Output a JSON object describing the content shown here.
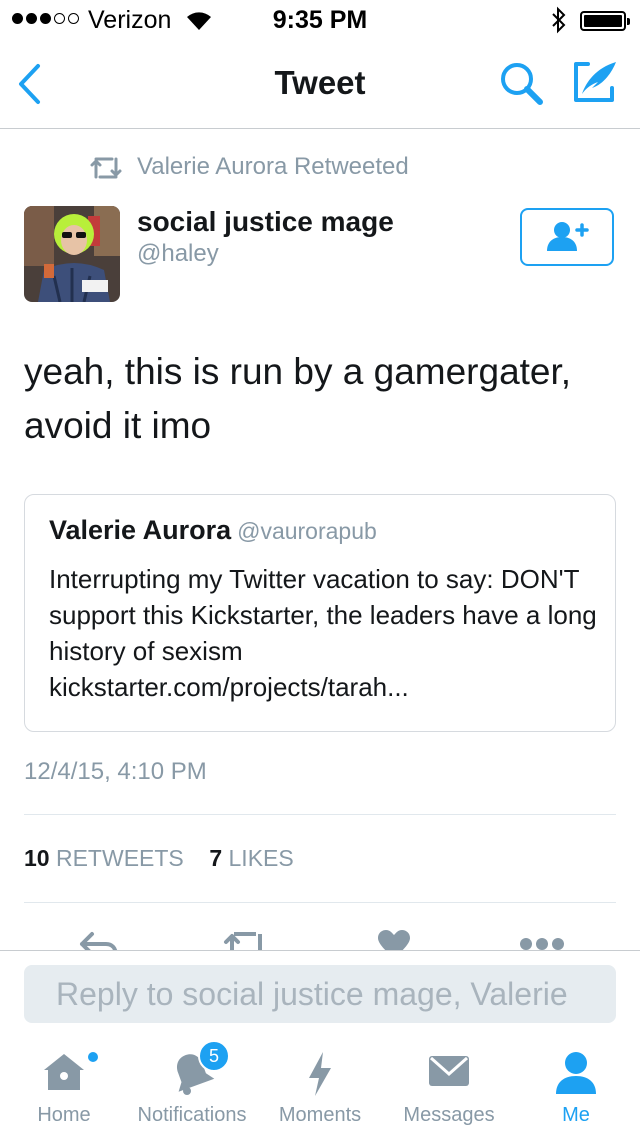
{
  "status_bar": {
    "carrier": "Verizon",
    "time": "9:35 PM",
    "signal_dots": [
      true,
      true,
      true,
      false,
      false
    ]
  },
  "nav": {
    "title": "Tweet",
    "icons": [
      "chevron-left-icon",
      "search-icon",
      "compose-icon"
    ]
  },
  "retweet_context": {
    "icon": "retweet-icon",
    "text": "Valerie Aurora Retweeted"
  },
  "tweet": {
    "author_name": "social justice mage",
    "author_handle": "@haley",
    "text": "yeah, this is run by a gamergater, avoid it imo",
    "date": "12/4/15, 4:10 PM",
    "retweets_count": "10",
    "retweets_label": "RETWEETS",
    "likes_count": "7",
    "likes_label": "LIKES"
  },
  "quoted_tweet": {
    "author_name": "Valerie Aurora",
    "author_handle": "@vaurorapub",
    "text": "Interrupting my Twitter vacation to say: DON'T support this Kickstarter, the leaders have a long history of sexism kickstarter.com/projects/tarah..."
  },
  "reply": {
    "placeholder": "Reply to social justice mage, Valerie"
  },
  "tabs": [
    {
      "label": "Home",
      "icon": "home-icon",
      "active": false,
      "dot": true
    },
    {
      "label": "Notifications",
      "icon": "bell-icon",
      "active": false,
      "badge": "5"
    },
    {
      "label": "Moments",
      "icon": "lightning-icon",
      "active": false
    },
    {
      "label": "Messages",
      "icon": "envelope-icon",
      "active": false
    },
    {
      "label": "Me",
      "icon": "person-icon",
      "active": true
    }
  ],
  "colors": {
    "accent": "#1da1f2",
    "muted": "#8899a6",
    "text": "#14171a"
  }
}
